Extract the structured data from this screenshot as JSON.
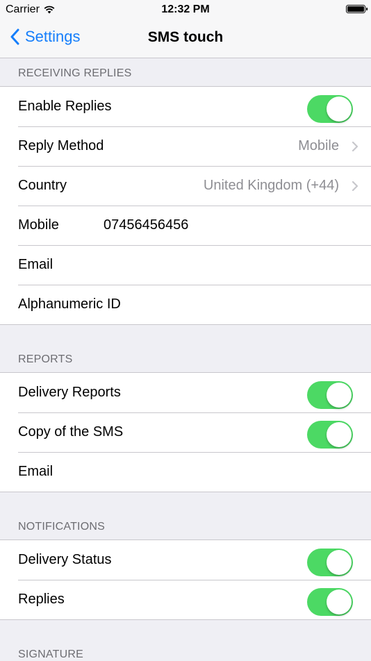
{
  "status_bar": {
    "carrier": "Carrier",
    "time": "12:32 PM"
  },
  "nav": {
    "back_label": "Settings",
    "title": "SMS touch"
  },
  "sections": {
    "receiving": {
      "header": "RECEIVING REPLIES",
      "enable_replies": {
        "label": "Enable Replies",
        "on": true
      },
      "reply_method": {
        "label": "Reply Method",
        "value": "Mobile"
      },
      "country": {
        "label": "Country",
        "value": "United Kingdom (+44)"
      },
      "mobile": {
        "label": "Mobile",
        "value": "07456456456"
      },
      "email": {
        "label": "Email"
      },
      "alphanumeric": {
        "label": "Alphanumeric ID"
      }
    },
    "reports": {
      "header": "REPORTS",
      "delivery_reports": {
        "label": "Delivery Reports",
        "on": true
      },
      "copy_sms": {
        "label": "Copy of the SMS",
        "on": true
      },
      "email": {
        "label": "Email"
      }
    },
    "notifications": {
      "header": "NOTIFICATIONS",
      "delivery_status": {
        "label": "Delivery Status",
        "on": true
      },
      "replies": {
        "label": "Replies",
        "on": true
      }
    },
    "signature": {
      "header": "SIGNATURE"
    }
  },
  "colors": {
    "accent": "#157efb",
    "toggle_on": "#4cd964",
    "secondary_text": "#8e8e93"
  }
}
